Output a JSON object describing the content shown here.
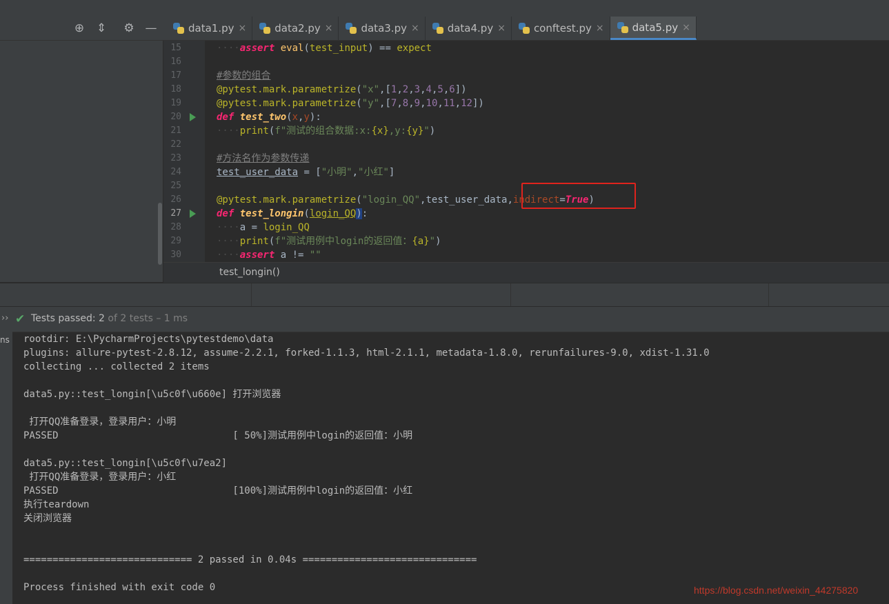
{
  "tabs": [
    {
      "label": "data1.py"
    },
    {
      "label": "data2.py"
    },
    {
      "label": "data3.py"
    },
    {
      "label": "data4.py"
    },
    {
      "label": "conftest.py"
    },
    {
      "label": "data5.py",
      "active": true
    }
  ],
  "toolbar_icons": [
    "crosshair-icon",
    "collapse-icon",
    "gear-icon",
    "minimize-icon"
  ],
  "editor": {
    "line_numbers": [
      "15",
      "16",
      "17",
      "18",
      "19",
      "20",
      "21",
      "22",
      "23",
      "24",
      "25",
      "26",
      "27",
      "28",
      "29",
      "30"
    ],
    "run_markers_at": [
      "20",
      "27"
    ],
    "highlighted_code": "indirect=True"
  },
  "breadcrumb": "test_longin()",
  "run": {
    "status_label": "Tests passed:",
    "passed": "2",
    "rest": " of 2 tests – 1 ms",
    "left_tab": "ns"
  },
  "console_lines": [
    "rootdir: E:\\PycharmProjects\\pytestdemo\\data",
    "plugins: allure-pytest-2.8.12, assume-2.2.1, forked-1.1.3, html-2.1.1, metadata-1.8.0, rerunfailures-9.0, xdist-1.31.0",
    "collecting ... collected 2 items",
    "",
    "data5.py::test_longin[\\u5c0f\\u660e] 打开浏览器",
    "",
    " 打开QQ准备登录，登录用户：小明",
    "PASSED                              [ 50%]测试用例中login的返回值：小明",
    "",
    "data5.py::test_longin[\\u5c0f\\u7ea2]",
    " 打开QQ准备登录，登录用户：小红",
    "PASSED                              [100%]测试用例中login的返回值：小红",
    "执行teardown",
    "关闭浏览器",
    "",
    "",
    "============================= 2 passed in 0.04s ==============================",
    "",
    "Process finished with exit code 0"
  ],
  "watermark": "https://blog.csdn.net/weixin_44275820",
  "colors": {
    "background": "#2b2b2b",
    "panel": "#3c3f41",
    "keyword": "#cc7832",
    "string": "#6a8759",
    "number": "#9876aa",
    "decorator": "#bbb529",
    "function": "#ffc66d",
    "pass_green": "#59a869",
    "highlight_box": "#e0231d"
  }
}
